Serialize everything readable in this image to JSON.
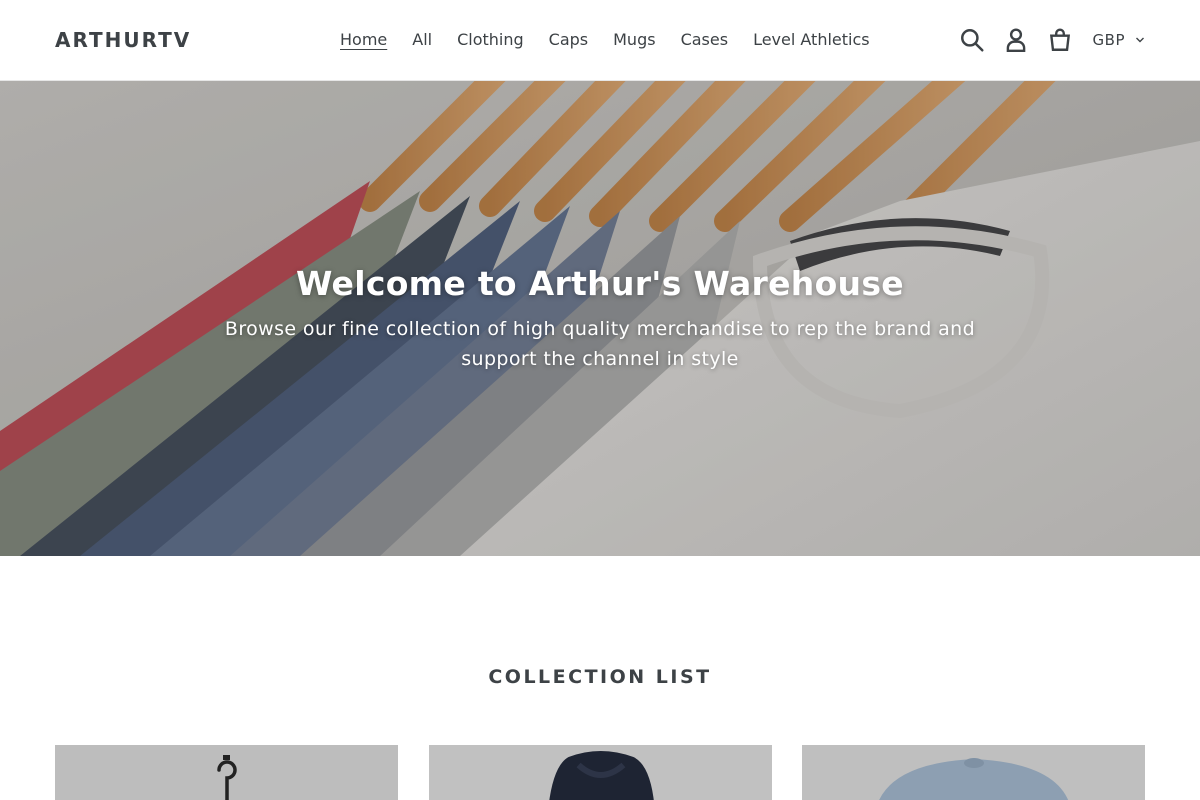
{
  "header": {
    "logo": "ARTHURTV",
    "nav": [
      {
        "label": "Home",
        "active": true
      },
      {
        "label": "All",
        "active": false
      },
      {
        "label": "Clothing",
        "active": false
      },
      {
        "label": "Caps",
        "active": false
      },
      {
        "label": "Mugs",
        "active": false
      },
      {
        "label": "Cases",
        "active": false
      },
      {
        "label": "Level Athletics",
        "active": false
      }
    ],
    "icons": [
      "search-icon",
      "account-icon",
      "cart-icon"
    ],
    "currency": "GBP"
  },
  "hero": {
    "title": "Welcome to Arthur's Warehouse",
    "subtitle": "Browse our fine collection of high quality merchandise to rep the brand and support the channel in style"
  },
  "collection": {
    "title": "COLLECTION LIST",
    "cards": [
      {
        "image": "hanger-image"
      },
      {
        "image": "hoodie-image"
      },
      {
        "image": "cap-image"
      }
    ]
  },
  "colors": {
    "text": "#3d4246",
    "header_bg": "#ffffff",
    "card_bg": "#bfbfbf"
  }
}
